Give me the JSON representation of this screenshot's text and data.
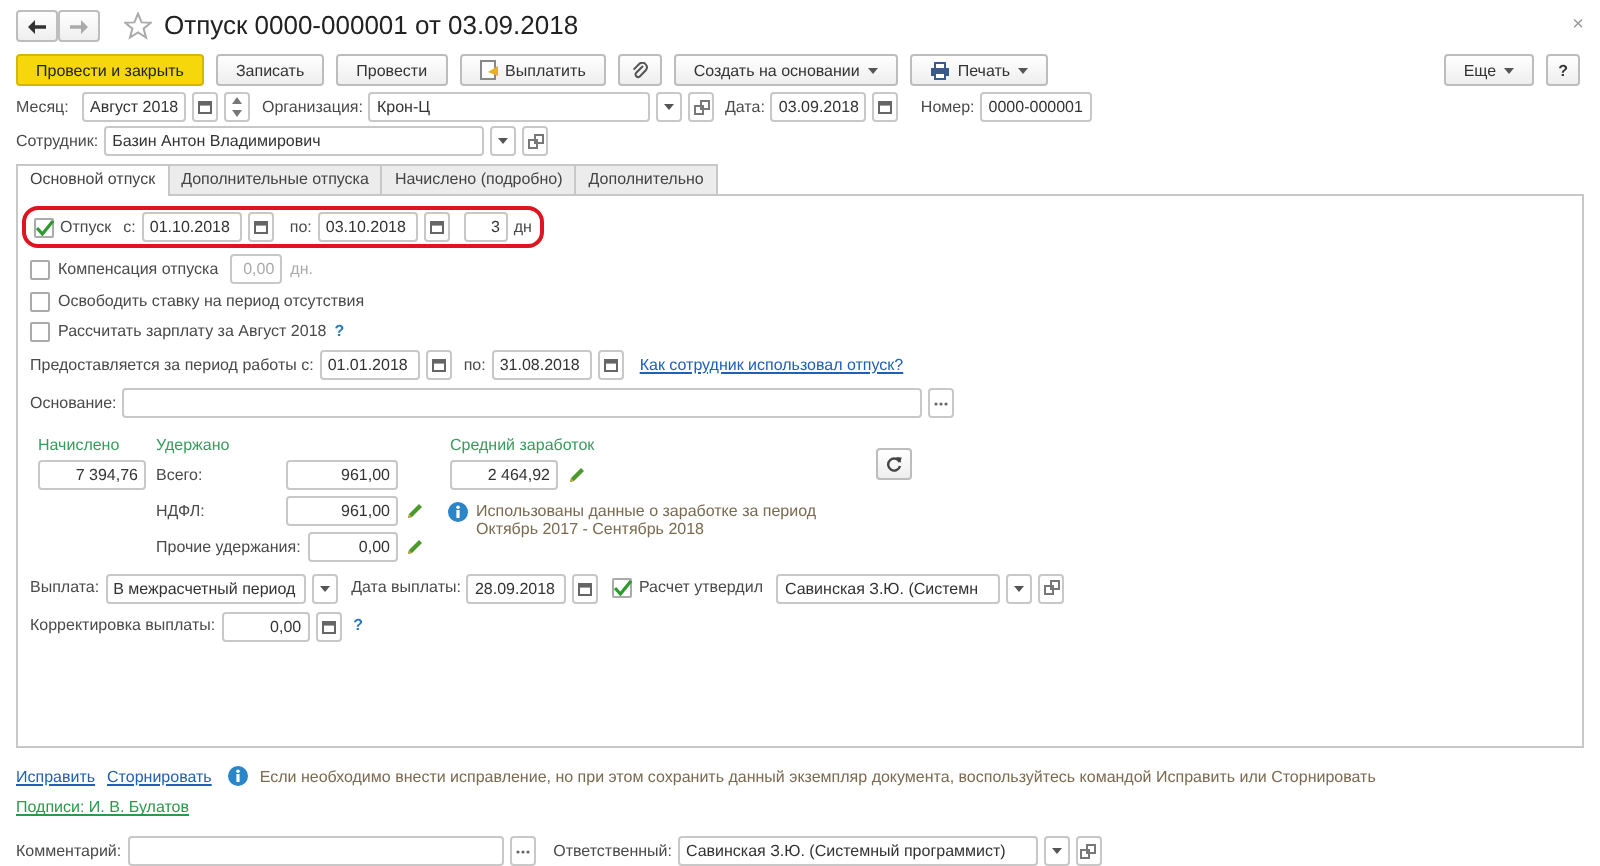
{
  "window": {
    "title": "Отпуск 0000-000001 от 03.09.2018",
    "favorite": false,
    "close": "×"
  },
  "toolbar": {
    "buttons": [
      {
        "label": "Провести и закрыть",
        "kind": "primary"
      },
      {
        "label": "Записать",
        "kind": "plain"
      },
      {
        "label": "Провести",
        "kind": "plain"
      },
      {
        "label": "Выплатить",
        "kind": "pay"
      },
      {
        "kind": "attach"
      },
      {
        "label": "Создать на основании",
        "kind": "menu"
      },
      {
        "label": "Печать",
        "kind": "print"
      }
    ],
    "more": "Еще",
    "help": "?"
  },
  "header": {
    "month": {
      "label": "Месяц:",
      "value": "Август 2018"
    },
    "organization": {
      "label": "Организация:",
      "value": "Крон-Ц"
    },
    "date": {
      "label": "Дата:",
      "value": "03.09.2018"
    },
    "number": {
      "label": "Номер:",
      "value": "0000-000001"
    },
    "employee": {
      "label": "Сотрудник:",
      "value": "Базин Антон Владимирович"
    }
  },
  "tabs": [
    {
      "label": "Основной отпуск",
      "selected": true
    },
    {
      "label": "Дополнительные отпуска",
      "selected": false
    },
    {
      "label": "Начислено (подробно)",
      "selected": false
    },
    {
      "label": "Дополнительно",
      "selected": false
    }
  ],
  "vacation": {
    "checked": true,
    "highlighted": true,
    "label": "Отпуск",
    "from_label": "с:",
    "from": "01.10.2018",
    "to_label": "по:",
    "to": "03.10.2018",
    "days": "3",
    "days_unit": "дн"
  },
  "options": [
    {
      "kind": "amount",
      "checked": false,
      "label": "Компенсация отпуска",
      "value": "0,00",
      "unit": "дн."
    },
    {
      "kind": "plain",
      "checked": false,
      "label": "Освободить ставку на период отсутствия"
    },
    {
      "kind": "help",
      "checked": false,
      "label": "Рассчитать зарплату за Август 2018",
      "help": "?"
    }
  ],
  "work_period": {
    "label": "Предоставляется за период работы с:",
    "from": "01.01.2018",
    "to_label": "по:",
    "to": "31.08.2018",
    "link": "Как сотрудник использовал отпуск?"
  },
  "basis": {
    "label": "Основание:"
  },
  "totals": {
    "accrued": {
      "heading": "Начислено",
      "value": "7 394,76"
    },
    "withheld": {
      "heading": "Удержано",
      "rows": [
        {
          "label": "Всего:",
          "value": "961,00",
          "editable": false
        },
        {
          "label": "НДФЛ:",
          "value": "961,00",
          "editable": true
        },
        {
          "label": "Прочие удержания:",
          "value": "0,00",
          "editable": true
        }
      ]
    },
    "average": {
      "heading": "Средний заработок",
      "value": "2 464,92",
      "note": "Использованы данные о заработке за период Октябрь 2017 - Сентябрь 2018"
    }
  },
  "payment": {
    "label": "Выплата:",
    "value": "В межрасчетный период",
    "date_label": "Дата выплаты:",
    "date": "28.09.2018",
    "approved": true,
    "approved_label": "Расчет утвердил",
    "approver": "Савинская З.Ю. (Системн"
  },
  "correction": {
    "label": "Корректировка выплаты:",
    "value": "0,00",
    "help": "?"
  },
  "footer": {
    "links": [
      "Исправить",
      "Сторнировать"
    ],
    "info": "Если необходимо внести исправление, но при этом сохранить данный экземпляр документа, воспользуйтесь командой Исправить или Сторнировать",
    "signatures": "Подписи: И. В. Булатов",
    "comment_label": "Комментарий:",
    "responsible_label": "Ответственный:",
    "responsible": "Савинская З.Ю. (Системный программист)"
  }
}
